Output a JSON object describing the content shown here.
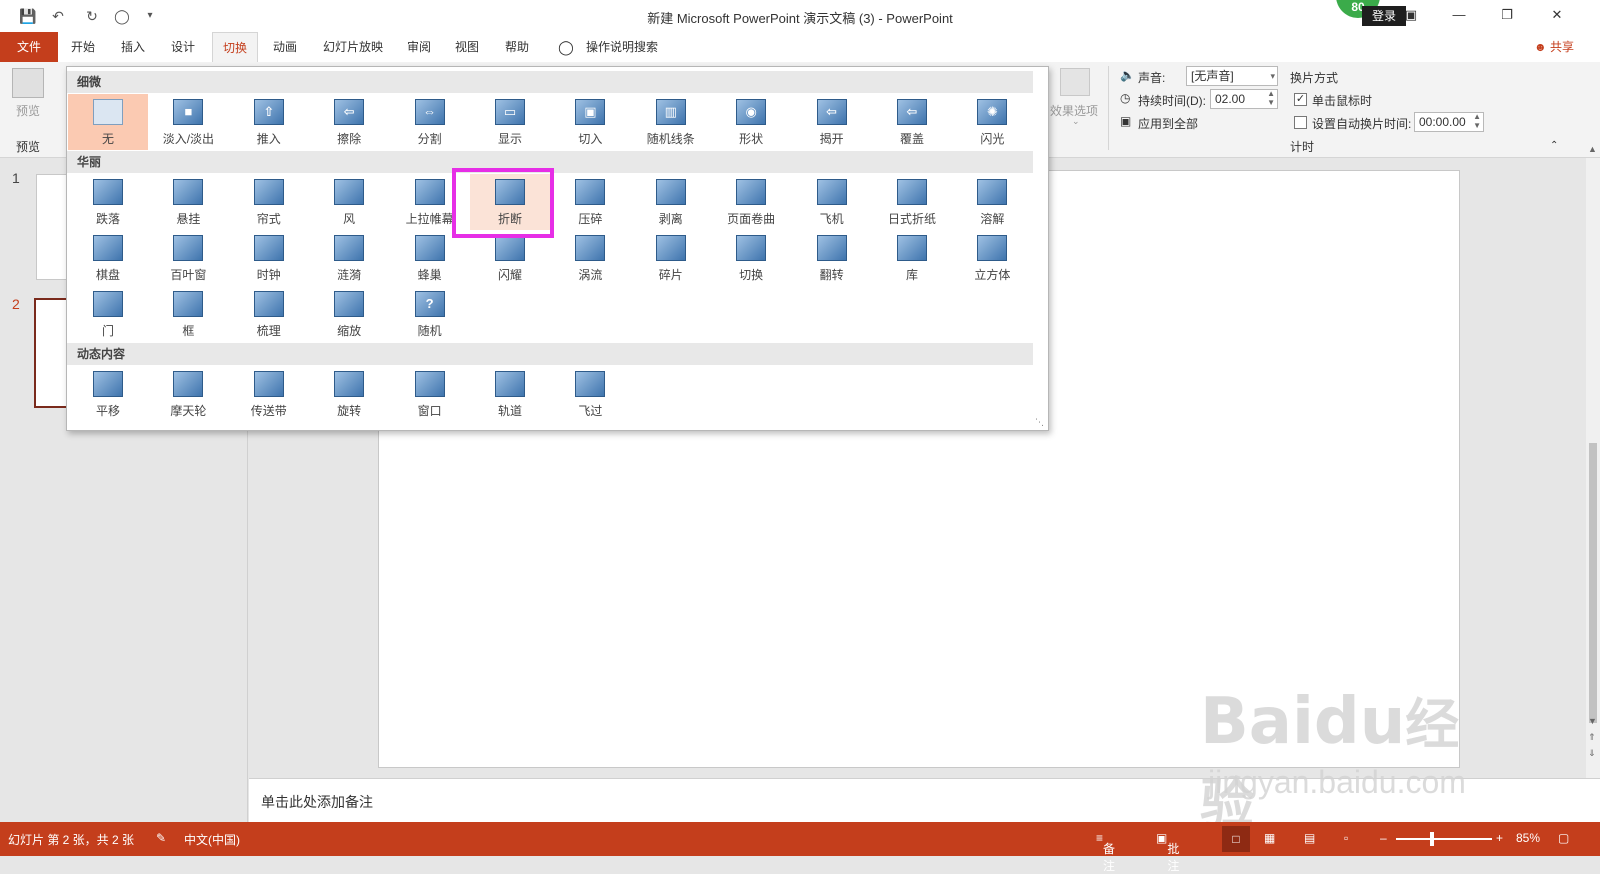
{
  "window": {
    "title": "新建 Microsoft PowerPoint 演示文稿 (3)  -  PowerPoint",
    "login": "登录",
    "badge": "80"
  },
  "tabs": [
    {
      "label": "文件"
    },
    {
      "label": "开始"
    },
    {
      "label": "插入"
    },
    {
      "label": "设计"
    },
    {
      "label": "切换"
    },
    {
      "label": "动画"
    },
    {
      "label": "幻灯片放映"
    },
    {
      "label": "审阅"
    },
    {
      "label": "视图"
    },
    {
      "label": "帮助"
    },
    {
      "label": "操作说明搜索"
    }
  ],
  "share": "共享",
  "ribbon": {
    "preview_btn": "预览",
    "preview_group": "预览",
    "effect_options": "效果选项",
    "sound_label": "声音:",
    "sound_value": "[无声音]",
    "duration_label": "持续时间(D):",
    "duration_value": "02.00",
    "apply_all": "应用到全部",
    "advance_title": "换片方式",
    "on_click": "单击鼠标时",
    "after_time": "设置自动换片时间:",
    "after_value": "00:00.00",
    "timing_group": "计时"
  },
  "gallery": {
    "categories": [
      "细微",
      "华丽",
      "动态内容"
    ],
    "subtle": [
      "无",
      "淡入/淡出",
      "推入",
      "擦除",
      "分割",
      "显示",
      "切入",
      "随机线条",
      "形状",
      "揭开",
      "覆盖",
      "闪光"
    ],
    "exciting_row1": [
      "跌落",
      "悬挂",
      "帘式",
      "风",
      "上拉帷幕",
      "折断",
      "压碎",
      "剥离",
      "页面卷曲",
      "飞机",
      "日式折纸",
      "溶解"
    ],
    "exciting_row2": [
      "棋盘",
      "百叶窗",
      "时钟",
      "涟漪",
      "蜂巢",
      "闪耀",
      "涡流",
      "碎片",
      "切换",
      "翻转",
      "库",
      "立方体"
    ],
    "exciting_row3": [
      "门",
      "框",
      "梳理",
      "缩放",
      "随机"
    ],
    "dynamic": [
      "平移",
      "摩天轮",
      "传送带",
      "旋转",
      "窗口",
      "轨道",
      "飞过"
    ]
  },
  "thumbs": {
    "n1": "1",
    "n2": "2"
  },
  "notes_placeholder": "单击此处添加备注",
  "status": {
    "slide_info": "幻灯片 第 2 张，共 2 张",
    "language": "中文(中国)",
    "notes": "备注",
    "comments": "批注",
    "zoom": "85%"
  },
  "watermark": {
    "brand": "Bai",
    "brand2": "du",
    "brand3": "经验",
    "url": "jingyan.baidu.com"
  },
  "colors": {
    "accent": "#c43e1c",
    "highlight": "#e62ee6",
    "selected": "#fbcab2"
  }
}
